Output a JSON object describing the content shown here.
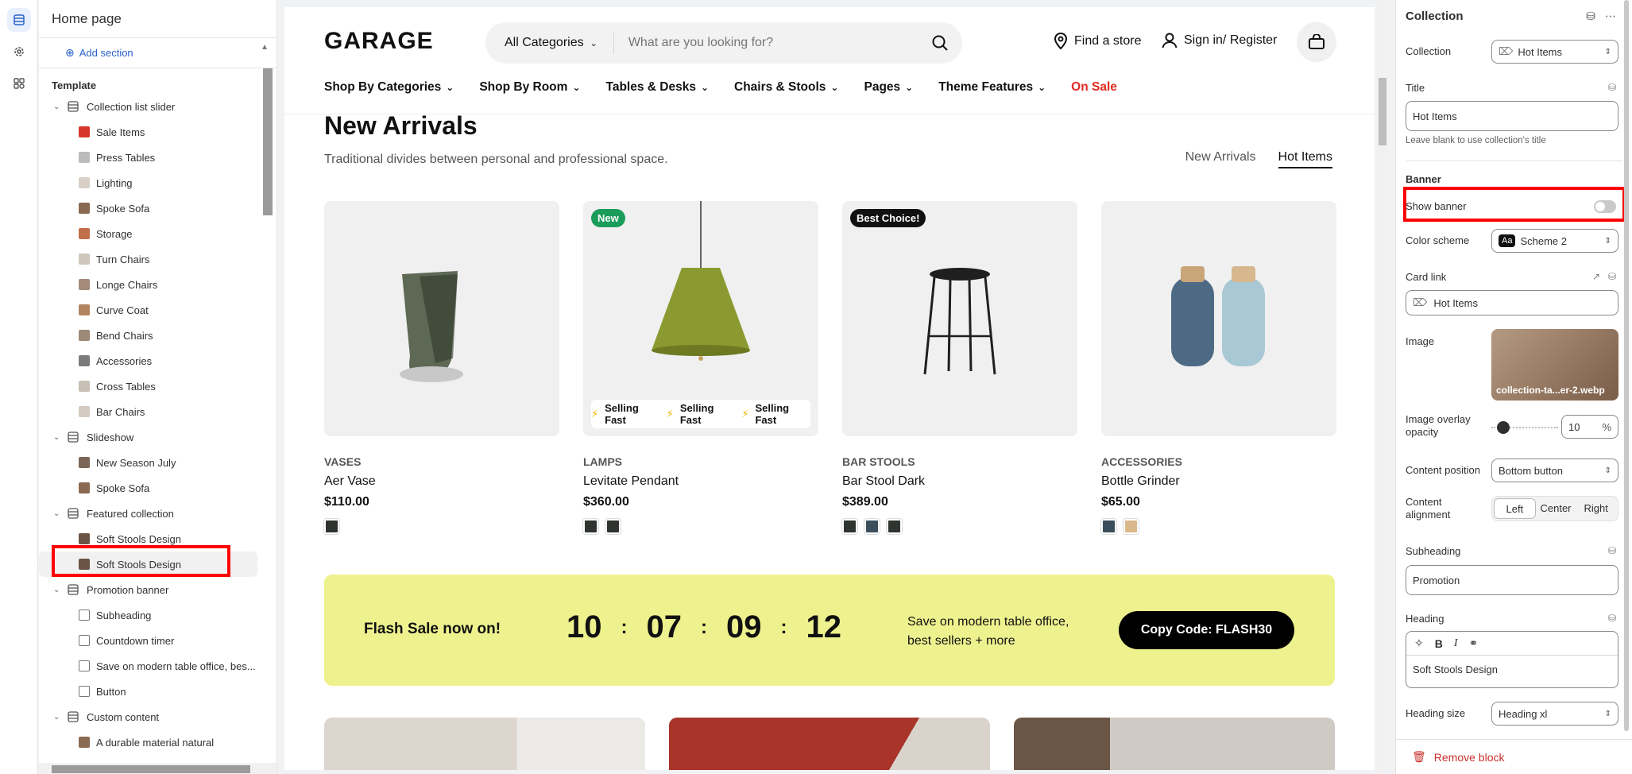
{
  "editor": {
    "page_name": "Home page",
    "add_section_label": "Add section",
    "template_label": "Template"
  },
  "tree": [
    {
      "type": "section",
      "label": "Collection list slider",
      "icon": "grid-icon"
    },
    {
      "type": "block",
      "label": "Sale Items",
      "color": "#d9362b"
    },
    {
      "type": "block",
      "label": "Press Tables",
      "color": "#bbbbbb"
    },
    {
      "type": "block",
      "label": "Lighting",
      "color": "#d8d0c6"
    },
    {
      "type": "block",
      "label": "Spoke Sofa",
      "color": "#8a6a52"
    },
    {
      "type": "block",
      "label": "Storage",
      "color": "#c2704a"
    },
    {
      "type": "block",
      "label": "Turn Chairs",
      "color": "#cfc7bc"
    },
    {
      "type": "block",
      "label": "Longe Chairs",
      "color": "#a48a78"
    },
    {
      "type": "block",
      "label": "Curve Coat",
      "color": "#b28460"
    },
    {
      "type": "block",
      "label": "Bend Chairs",
      "color": "#9c8978"
    },
    {
      "type": "block",
      "label": "Accessories",
      "color": "#7b7b7b"
    },
    {
      "type": "block",
      "label": "Cross Tables",
      "color": "#c9c0b6"
    },
    {
      "type": "block",
      "label": "Bar Chairs",
      "color": "#d3cbc2"
    },
    {
      "type": "section",
      "label": "Slideshow",
      "icon": "slideshow-icon"
    },
    {
      "type": "block",
      "label": "New Season July",
      "color": "#7c6656"
    },
    {
      "type": "block",
      "label": "Spoke Sofa",
      "color": "#8a6a52"
    },
    {
      "type": "section",
      "label": "Featured collection",
      "icon": "grid-icon"
    },
    {
      "type": "block",
      "label": "Soft Stools Design",
      "color": "#6b5444"
    },
    {
      "type": "block",
      "label": "Soft Stools Design",
      "color": "#6b5444",
      "selected": true
    },
    {
      "type": "section",
      "label": "Promotion banner",
      "icon": "grid-icon"
    },
    {
      "type": "block",
      "label": "Subheading",
      "icon": "text-icon"
    },
    {
      "type": "block",
      "label": "Countdown timer",
      "icon": "lines-icon"
    },
    {
      "type": "block",
      "label": "Save on modern table office, bes...",
      "icon": "lines-icon"
    },
    {
      "type": "block",
      "label": "Button",
      "icon": "button-icon"
    },
    {
      "type": "section",
      "label": "Custom content",
      "icon": "list-icon"
    },
    {
      "type": "block",
      "label": "A durable material natural",
      "color": "#8a6a52"
    }
  ],
  "store": {
    "logo": "GARAGE",
    "search_category": "All Categories",
    "search_placeholder": "What are you looking for?",
    "find_store": "Find a store",
    "sign_in": "Sign in/ Register",
    "nav": [
      "Shop By Categories",
      "Shop By Room",
      "Tables & Desks",
      "Chairs & Stools",
      "Pages",
      "Theme Features"
    ],
    "nav_sale": "On Sale",
    "section_title": "New Arrivals",
    "section_subtitle": "Traditional divides between personal and professional space.",
    "tabs": [
      "New Arrivals",
      "Hot Items"
    ],
    "active_tab": "Hot Items"
  },
  "products": [
    {
      "category": "VASES",
      "name": "Aer Vase",
      "price": "$110.00",
      "swatches": [
        "#2f3430"
      ]
    },
    {
      "category": "LAMPS",
      "name": "Levitate Pendant",
      "price": "$360.00",
      "badge": "New",
      "badge_color": "#1a9c5b",
      "swatches": [
        "#2f3430",
        "#2f3430"
      ],
      "marquee": [
        "Selling Fast",
        "Selling Fast",
        "Selling Fast"
      ]
    },
    {
      "category": "BAR STOOLS",
      "name": "Bar Stool Dark",
      "price": "$389.00",
      "badge": "Best Choice!",
      "badge_color": "#111111",
      "swatches": [
        "#2f3430",
        "#3a4e5c",
        "#2f3430"
      ]
    },
    {
      "category": "ACCESSORIES",
      "name": "Bottle Grinder",
      "price": "$65.00",
      "swatches": [
        "#3a4e5c",
        "#d9b98c"
      ]
    }
  ],
  "promo": {
    "title": "Flash Sale now on!",
    "timer": [
      "10",
      "07",
      "09",
      "12"
    ],
    "separator": ":",
    "text_line1": "Save on modern table office,",
    "text_line2": "best sellers + more",
    "button": "Copy Code: FLASH30",
    "bg_color": "#eef28e"
  },
  "panel": {
    "title": "Collection",
    "collection_label": "Collection",
    "collection_value": "Hot Items",
    "title_label": "Title",
    "title_value": "Hot Items",
    "title_hint": "Leave blank to use collection's title",
    "banner_heading": "Banner",
    "show_banner_label": "Show banner",
    "show_banner_on": false,
    "color_scheme_label": "Color scheme",
    "color_scheme_value": "Scheme 2",
    "color_scheme_swatch": "Aa",
    "card_link_label": "Card link",
    "card_link_value": "Hot Items",
    "image_label": "Image",
    "image_caption": "collection-ta...er-2.webp",
    "overlay_label": "Image overlay opacity",
    "overlay_value": "10",
    "overlay_unit": "%",
    "overlay_fraction": 0.1,
    "content_position_label": "Content position",
    "content_position_value": "Bottom button",
    "content_alignment_label": "Content alignment",
    "alignment_options": [
      "Left",
      "Center",
      "Right"
    ],
    "alignment_selected": "Left",
    "subheading_label": "Subheading",
    "subheading_value": "Promotion",
    "heading_label": "Heading",
    "heading_value": "Soft Stools Design",
    "heading_size_label": "Heading size",
    "heading_size_value": "Heading xl",
    "remove_block": "Remove block"
  }
}
